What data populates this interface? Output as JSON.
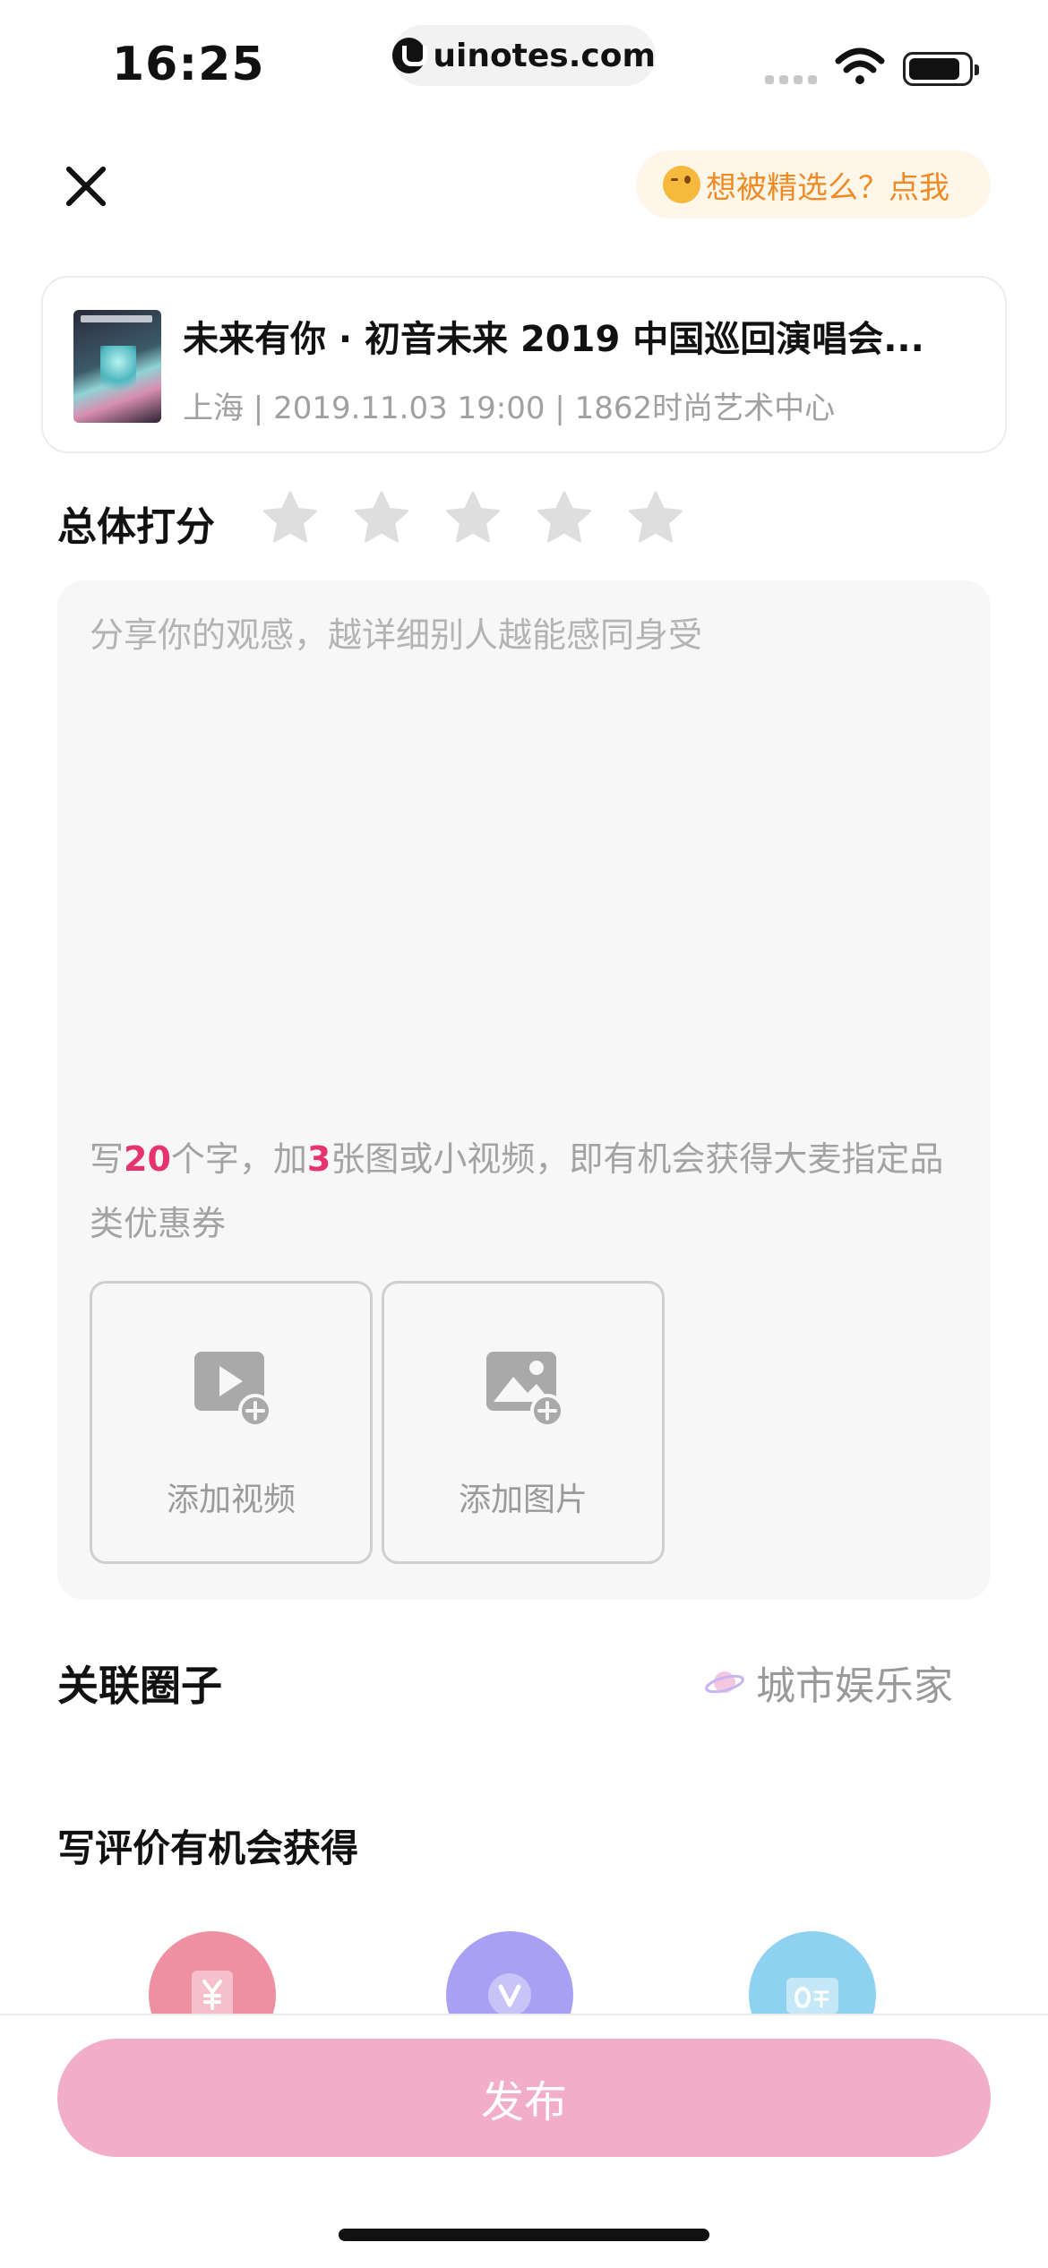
{
  "status_bar": {
    "time": "16:25",
    "url": "uinotes.com",
    "icons": [
      "cellular-signal-icon",
      "wifi-icon",
      "battery-icon"
    ]
  },
  "header": {
    "close_icon": "close-icon",
    "featured_prompt": "想被精选么？点我",
    "featured_emoji": "wink-emoji-icon"
  },
  "event": {
    "title": "未来有你 · 初音未来 2019 中国巡回演唱会...",
    "meta": "上海 | 2019.11.03 19:00 | 1862时尚艺术中心"
  },
  "rating": {
    "label": "总体打分",
    "max_stars": 5,
    "selected_stars": 0
  },
  "review": {
    "placeholder": "分享你的观感，越详细别人越能感同身受",
    "hint_prefix": "写",
    "hint_words_count": "20",
    "hint_mid": "个字，加",
    "hint_images_count": "3",
    "hint_suffix": "张图或小视频，即有机会获得大麦指定品类优惠券",
    "add_video_label": "添加视频",
    "add_image_label": "添加图片"
  },
  "circle": {
    "label": "关联圈子",
    "value": "城市娱乐家"
  },
  "rewards": {
    "label": "写评价有机会获得",
    "items": [
      {
        "icon": "yuan-coupon-icon",
        "color": "#ee8fa2"
      },
      {
        "icon": "v-badge-icon",
        "color": "#a8a1f3"
      },
      {
        "icon": "zero-yuan-ticket-icon",
        "color": "#8fd1f0"
      }
    ]
  },
  "publish": {
    "label": "发布"
  },
  "colors": {
    "accent": "#e6336e",
    "publish_button": "#f2adc8",
    "featured_text": "#f08a24",
    "featured_bg": "#fff6ea"
  }
}
